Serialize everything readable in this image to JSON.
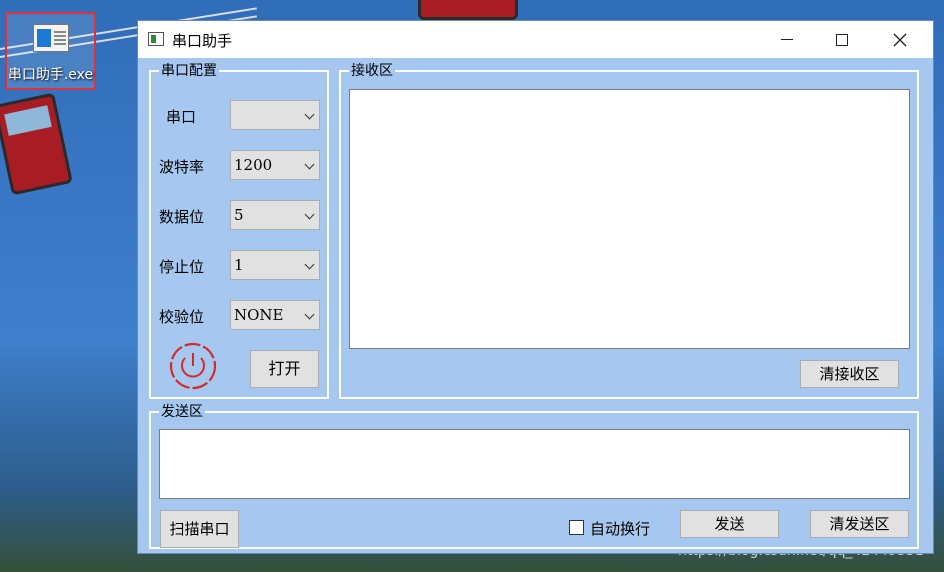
{
  "desktop": {
    "icon_label": "串口助手.exe",
    "watermark": "https://blog.csdn.net/qq_42449351"
  },
  "window": {
    "title": "串口助手",
    "controls": {
      "minimize": "—",
      "maximize": "☐",
      "close": "✕"
    }
  },
  "config": {
    "group_title": "串口配置",
    "fields": [
      {
        "label": "串口",
        "value": ""
      },
      {
        "label": "波特率",
        "value": "1200"
      },
      {
        "label": "数据位",
        "value": "5"
      },
      {
        "label": "停止位",
        "value": "1"
      },
      {
        "label": "校验位",
        "value": "NONE"
      }
    ],
    "open_button": "打开",
    "power_color": "#d42a2a"
  },
  "receive": {
    "group_title": "接收区",
    "text": "",
    "clear_button": "清接收区"
  },
  "send": {
    "group_title": "发送区",
    "text": "",
    "scan_button": "扫描串口",
    "auto_newline_label": "自动换行",
    "auto_newline_checked": false,
    "send_button": "发送",
    "clear_button": "清发送区"
  }
}
